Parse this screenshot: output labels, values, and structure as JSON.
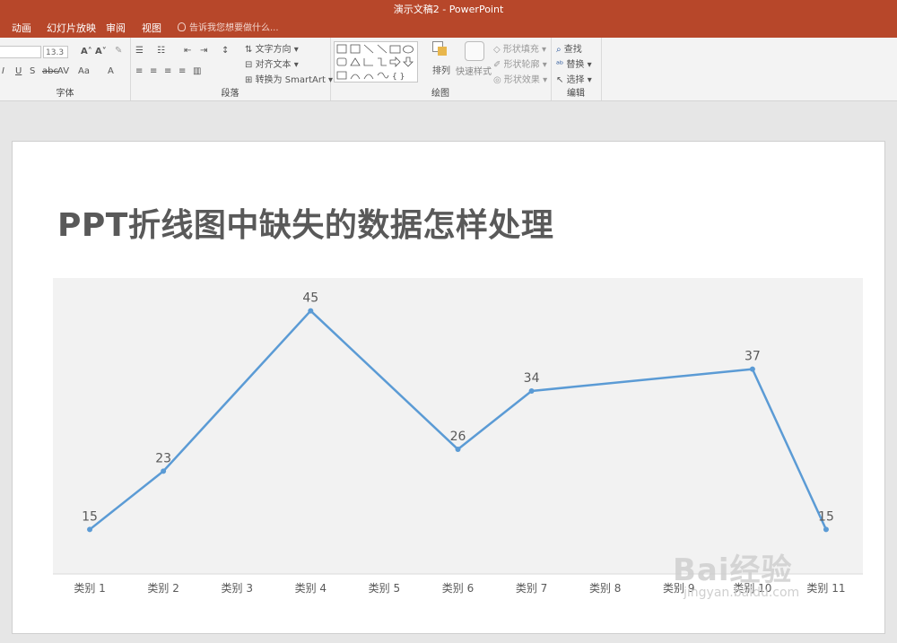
{
  "window": {
    "title": "演示文稿2 - PowerPoint"
  },
  "tabs": [
    {
      "label": "动画"
    },
    {
      "label": "幻灯片放映"
    },
    {
      "label": "审阅"
    },
    {
      "label": "视图"
    }
  ],
  "tell_me": {
    "placeholder": "告诉我您想要做什么..."
  },
  "ribbon": {
    "font_size_value": "13.3",
    "font_group_label": "字体",
    "paragraph_group_label": "段落",
    "drawing_group_label": "绘图",
    "editing_group_label": "编辑",
    "text_direction": "文字方向",
    "align_text": "对齐文本",
    "convert_smartart": "转换为 SmartArt",
    "arrange": "排列",
    "quick_styles": "快速样式",
    "shape_fill": "形状填充",
    "shape_outline": "形状轮廓",
    "shape_effects": "形状效果",
    "find": "查找",
    "replace": "替换",
    "select": "选择"
  },
  "slide": {
    "title": "PPT折线图中缺失的数据怎样处理"
  },
  "chart_data": {
    "type": "line",
    "categories": [
      "类别 1",
      "类别 2",
      "类别 3",
      "类别 4",
      "类别 5",
      "类别 6",
      "类别 7",
      "类别 8",
      "类别 9",
      "类别 10",
      "类别 11"
    ],
    "points": [
      {
        "x": "类别 1",
        "y": 15
      },
      {
        "x": "类别 2",
        "y": 23
      },
      {
        "x": "类别 4",
        "y": 45
      },
      {
        "x": "类别 6",
        "y": 26
      },
      {
        "x": "类别 7",
        "y": 34
      },
      {
        "x": "类别 10",
        "y": 37
      },
      {
        "x": "类别 11",
        "y": 15
      }
    ],
    "ylim": [
      8.9,
      49.5
    ],
    "grid": false,
    "line_color": "#5b9bd5",
    "label_color": "#595959",
    "gaps": "connected"
  },
  "watermark": {
    "main": "Bai经验",
    "sub": "jingyan.baidu.com"
  }
}
